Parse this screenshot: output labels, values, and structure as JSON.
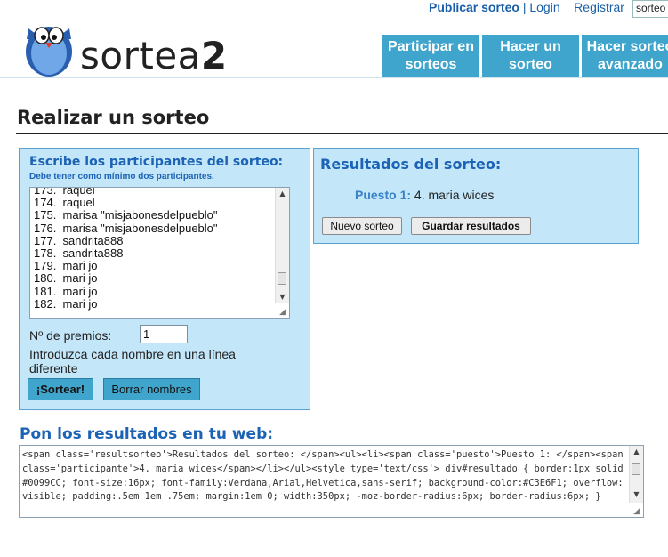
{
  "brand": {
    "name_plain": "sortea",
    "name_bold": "2"
  },
  "top_links": {
    "publish": "Publicar sorteo",
    "separator": "|",
    "login": "Login",
    "register": "Registrar",
    "search_value": "sorteo"
  },
  "nav": [
    {
      "line1": "Participar en",
      "line2": "sorteos"
    },
    {
      "line1": "Hacer un",
      "line2": "sorteo"
    },
    {
      "line1": "Hacer sorteo",
      "line2": "avanzado"
    }
  ],
  "page_title": "Realizar un sorteo",
  "participants_panel": {
    "heading": "Escribe los participantes del sorteo:",
    "note": "Debe tener como mínimo dos participantes.",
    "entries": [
      "173.  raquel",
      "174.  raquel",
      "175.  marisa \"misjabonesdelpueblo\"",
      "176.  marisa \"misjabonesdelpueblo\"",
      "177.  sandrita888",
      "178.  sandrita888",
      "179.  mari jo",
      "180.  mari jo",
      "181.  mari jo",
      "182.  mari jo"
    ],
    "prizes_label": "Nº de premios:",
    "prizes_value": "1",
    "instructions": "Introduzca cada nombre en una línea diferente",
    "draw_button": "¡Sortear!",
    "clear_button": "Borrar nombres"
  },
  "results_panel": {
    "heading": "Resultados del sorteo:",
    "position_label": "Puesto 1:",
    "winner": "4. maria wices",
    "new_button": "Nuevo sorteo",
    "save_button": "Guardar resultados"
  },
  "embed": {
    "heading": "Pon los resultados en tu web:",
    "code": "<span class='resultsorteo'>Resultados del sorteo: </span><ul><li><span class='puesto'>Puesto 1: </span><span class='participante'>4. maria wices</span></li></ul><style type='text/css'> div#resultado { border:1px solid #0099CC; font-size:16px; font-family:Verdana,Arial,Helvetica,sans-serif; background-color:#C3E6F1; overflow:visible; padding:.5em 1em .75em; margin:1em 0; width:350px; -moz-border-radius:6px; border-radius:6px; }"
  },
  "colors": {
    "accent": "#3fa5cc",
    "panel_bg": "#c3e6f9",
    "heading_blue": "#1c63b5"
  }
}
